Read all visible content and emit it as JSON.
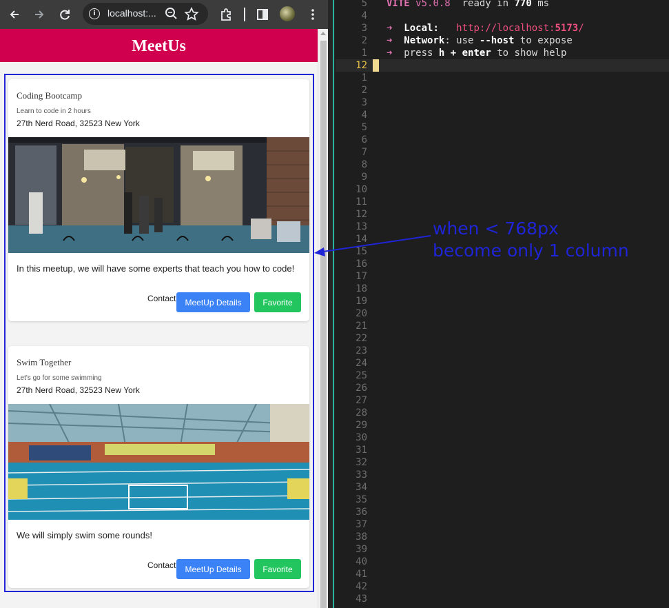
{
  "browser": {
    "url": "localhost:...",
    "icons": {
      "back": "arrow-left-icon",
      "forward": "arrow-right-icon",
      "reload": "reload-icon",
      "site_info": "info-icon",
      "zoom": "zoom-icon",
      "bookmark": "star-icon",
      "extensions": "puzzle-icon",
      "side_panel": "side-panel-icon",
      "menu": "kebab-menu-icon"
    }
  },
  "app": {
    "title": "MeetUs",
    "header_color": "#d1004f",
    "meetups": [
      {
        "title": "Coding Bootcamp",
        "subtitle": "Learn to code in 2 hours",
        "address": "27th Nerd Road, 32523 New York",
        "image": "cafe-storefront-photo",
        "description": "In this meetup, we will have some experts that teach you how to code!",
        "contact_label": "Contact",
        "details_label": "MeetUp Details",
        "favorite_label": "Favorite"
      },
      {
        "title": "Swim Together",
        "subtitle": "Let's go for some swimming",
        "address": "27th Nerd Road, 32523 New York",
        "image": "swimming-pool-photo",
        "description": "We will simply swim some rounds!",
        "contact_label": "Contact",
        "details_label": "MeetUp Details",
        "favorite_label": "Favorite"
      }
    ],
    "colors": {
      "details_button": "#3b82f6",
      "favorite_button": "#22c55e"
    }
  },
  "terminal": {
    "line_numbers": [
      "5",
      "4",
      "3",
      "2",
      "1",
      "12",
      "1",
      "2",
      "3",
      "4",
      "5",
      "6",
      "7",
      "8",
      "9",
      "10",
      "11",
      "12",
      "13",
      "14",
      "15",
      "16",
      "17",
      "18",
      "19",
      "20",
      "21",
      "22",
      "23",
      "24",
      "25",
      "26",
      "27",
      "28",
      "29",
      "30",
      "31",
      "32",
      "33",
      "34",
      "35",
      "36",
      "37",
      "38",
      "39",
      "40",
      "41",
      "42",
      "43"
    ],
    "vite_name": "VITE",
    "vite_version": "v5.0.8",
    "ready_text": "ready in",
    "ready_ms": "770",
    "ms_label": "ms",
    "arrow_glyph": "➜",
    "local_label": "Local:",
    "local_url_base": "http://localhost:",
    "local_url_port": "5173",
    "local_url_slash": "/",
    "network_label": "Network",
    "network_text_1": ": use",
    "network_flag": "--host",
    "network_text_2": "to expose",
    "help_text_1": "press",
    "help_key_h": "h",
    "help_plus": "+",
    "help_key_enter": "enter",
    "help_text_2": "to show help"
  },
  "annotation": {
    "line1": "when < 768px",
    "line2": "become only 1 column",
    "color": "#1f24d6"
  }
}
